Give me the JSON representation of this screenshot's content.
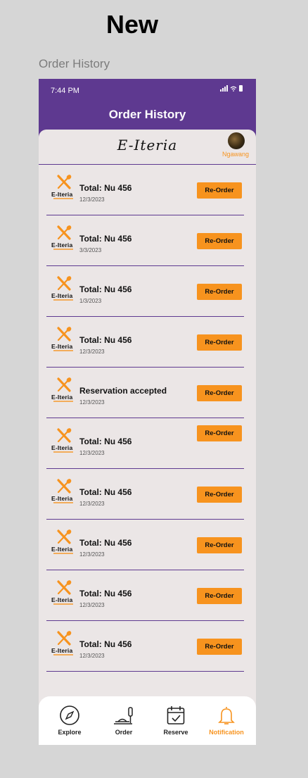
{
  "canvas": {
    "title": "New",
    "frame_label": "Order History"
  },
  "status": {
    "time": "7:44 PM"
  },
  "header": {
    "title": "Order History"
  },
  "brand": {
    "name": "E-Iteria",
    "user_name": "Ngawang"
  },
  "logo_text": "E-Iteria",
  "orders": [
    {
      "title": "Total: Nu 456",
      "date": "12/3/2023",
      "button": "Re-Order"
    },
    {
      "title": "Total: Nu 456",
      "date": "3/3/2023",
      "button": "Re-Order"
    },
    {
      "title": "Total: Nu 456",
      "date": "1/3/2023",
      "button": "Re-Order"
    },
    {
      "title": "Total: Nu 456",
      "date": "12/3/2023",
      "button": "Re-Order"
    },
    {
      "title": "Reservation accepted",
      "date": "12/3/2023",
      "button": "Re-Order"
    },
    {
      "title": "Total: Nu 456",
      "date": "12/3/2023",
      "button": "Re-Order"
    },
    {
      "title": "Total: Nu 456",
      "date": "12/3/2023",
      "button": "Re-Order"
    },
    {
      "title": "Total: Nu 456",
      "date": "12/3/2023",
      "button": "Re-Order"
    },
    {
      "title": "Total: Nu 456",
      "date": "12/3/2023",
      "button": "Re-Order"
    },
    {
      "title": "Total: Nu 456",
      "date": "12/3/2023",
      "button": "Re-Order"
    }
  ],
  "nav": {
    "items": [
      {
        "label": "Explore",
        "icon": "compass-icon"
      },
      {
        "label": "Order",
        "icon": "dish-icon"
      },
      {
        "label": "Reserve",
        "icon": "calendar-check-icon"
      },
      {
        "label": "Notification",
        "icon": "bell-icon"
      }
    ],
    "active": "Notification"
  },
  "colors": {
    "header": "#5e3990",
    "accent": "#f7931e",
    "background": "#ebe6e6",
    "canvas": "#d6d6d6"
  }
}
